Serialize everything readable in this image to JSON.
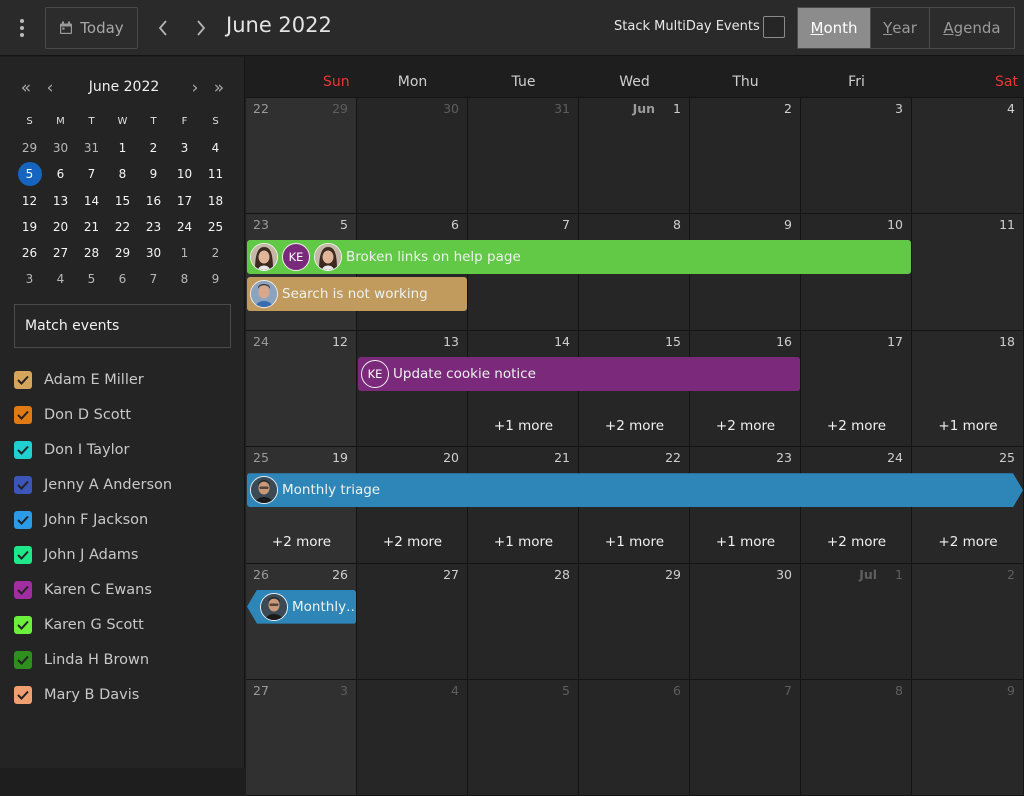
{
  "toolbar": {
    "today_label": "Today",
    "title": "June 2022",
    "stack_label": "Stack MultiDay Events",
    "views": [
      {
        "first": "M",
        "rest": "onth",
        "active": true
      },
      {
        "first": "Y",
        "rest": "ear",
        "active": false
      },
      {
        "first": "A",
        "rest": "genda",
        "active": false
      }
    ]
  },
  "mini": {
    "title": "June 2022",
    "first_nav": "«",
    "prev_nav": "‹",
    "next_nav": "›",
    "last_nav": "»",
    "dow": [
      "S",
      "M",
      "T",
      "W",
      "T",
      "F",
      "S"
    ],
    "weeks": [
      [
        "29",
        "30",
        "31",
        "1",
        "2",
        "3",
        "4"
      ],
      [
        "5",
        "6",
        "7",
        "8",
        "9",
        "10",
        "11"
      ],
      [
        "12",
        "13",
        "14",
        "15",
        "16",
        "17",
        "18"
      ],
      [
        "19",
        "20",
        "21",
        "22",
        "23",
        "24",
        "25"
      ],
      [
        "26",
        "27",
        "28",
        "29",
        "30",
        "1",
        "2"
      ],
      [
        "3",
        "4",
        "5",
        "6",
        "7",
        "8",
        "9"
      ]
    ],
    "out_of_month": [
      [
        0,
        0
      ],
      [
        0,
        1
      ],
      [
        0,
        2
      ],
      [
        4,
        5
      ],
      [
        4,
        6
      ],
      [
        5,
        0
      ],
      [
        5,
        1
      ],
      [
        5,
        2
      ],
      [
        5,
        3
      ],
      [
        5,
        4
      ],
      [
        5,
        5
      ],
      [
        5,
        6
      ]
    ],
    "selected": "5"
  },
  "match_label": "Match events",
  "people": [
    {
      "name": "Adam E Miller",
      "color": "#d6a55c"
    },
    {
      "name": "Don D Scott",
      "color": "#e07a14"
    },
    {
      "name": "Don I Taylor",
      "color": "#1fd1d1"
    },
    {
      "name": "Jenny A Anderson",
      "color": "#3b55b8"
    },
    {
      "name": "John F Jackson",
      "color": "#2b9be8"
    },
    {
      "name": "John J Adams",
      "color": "#1ee88a"
    },
    {
      "name": "Karen C Ewans",
      "color": "#a02ea0"
    },
    {
      "name": "Karen G Scott",
      "color": "#6cf03c"
    },
    {
      "name": "Linda H Brown",
      "color": "#2e8f1e"
    },
    {
      "name": "Mary B Davis",
      "color": "#f0a070"
    }
  ],
  "calendar": {
    "dow": [
      {
        "label": "Sun",
        "color": "#e53935"
      },
      {
        "label": "Mon",
        "color": "#cfcfcf"
      },
      {
        "label": "Tue",
        "color": "#cfcfcf"
      },
      {
        "label": "Wed",
        "color": "#cfcfcf"
      },
      {
        "label": "Thu",
        "color": "#cfcfcf"
      },
      {
        "label": "Fri",
        "color": "#cfcfcf"
      },
      {
        "label": "Sat",
        "color": "#e53935"
      }
    ],
    "weeks": [
      {
        "num": "22",
        "days": [
          {
            "d": "29",
            "dim": true
          },
          {
            "d": "30",
            "dim": true
          },
          {
            "d": "31",
            "dim": true
          },
          {
            "d": "1",
            "m": "Jun"
          },
          {
            "d": "2"
          },
          {
            "d": "3"
          },
          {
            "d": "4"
          }
        ]
      },
      {
        "num": "23",
        "days": [
          {
            "d": "5"
          },
          {
            "d": "6"
          },
          {
            "d": "7"
          },
          {
            "d": "8"
          },
          {
            "d": "9"
          },
          {
            "d": "10"
          },
          {
            "d": "11"
          }
        ]
      },
      {
        "num": "24",
        "days": [
          {
            "d": "12"
          },
          {
            "d": "13"
          },
          {
            "d": "14"
          },
          {
            "d": "15"
          },
          {
            "d": "16"
          },
          {
            "d": "17"
          },
          {
            "d": "18"
          }
        ]
      },
      {
        "num": "25",
        "days": [
          {
            "d": "19"
          },
          {
            "d": "20"
          },
          {
            "d": "21"
          },
          {
            "d": "22"
          },
          {
            "d": "23"
          },
          {
            "d": "24"
          },
          {
            "d": "25"
          }
        ]
      },
      {
        "num": "26",
        "days": [
          {
            "d": "26"
          },
          {
            "d": "27"
          },
          {
            "d": "28"
          },
          {
            "d": "29"
          },
          {
            "d": "30"
          },
          {
            "d": "1",
            "m": "Jul",
            "dim": true
          },
          {
            "d": "2",
            "dim": true
          }
        ]
      },
      {
        "num": "27",
        "days": [
          {
            "d": "3",
            "dim": true
          },
          {
            "d": "4",
            "dim": true
          },
          {
            "d": "5",
            "dim": true
          },
          {
            "d": "6",
            "dim": true
          },
          {
            "d": "7",
            "dim": true
          },
          {
            "d": "8",
            "dim": true
          },
          {
            "d": "9",
            "dim": true
          }
        ]
      }
    ],
    "events": [
      {
        "title": "Broken links on help page",
        "week": 1,
        "start": 0,
        "end": 6,
        "lane": 0,
        "color": "#62c946",
        "avatars": [
          "photo-woman",
          "KE",
          "photo-woman"
        ],
        "shape": "plain"
      },
      {
        "title": "Search is not working",
        "week": 1,
        "start": 0,
        "end": 2,
        "lane": 1,
        "color": "#c19a5e",
        "avatars": [
          "photo-man"
        ],
        "shape": "plain"
      },
      {
        "title": "Update cookie notice",
        "week": 2,
        "start": 1,
        "end": 5,
        "lane": 0,
        "color": "#7b2a7b",
        "avatars": [
          "KE"
        ],
        "shape": "plain"
      },
      {
        "title": "Monthly triage",
        "week": 3,
        "start": 0,
        "end": 7,
        "lane": 0,
        "color": "#2e86b8",
        "avatars": [
          "photo-man2"
        ],
        "shape": "arrow-right"
      },
      {
        "title": "Monthly…",
        "week": 4,
        "start": 0,
        "end": 1,
        "lane": 0,
        "color": "#2e86b8",
        "avatars": [
          "photo-man2"
        ],
        "shape": "arrow-left"
      }
    ],
    "more": [
      {
        "week": 2,
        "col": 2,
        "label": "+1 more"
      },
      {
        "week": 2,
        "col": 3,
        "label": "+2 more"
      },
      {
        "week": 2,
        "col": 4,
        "label": "+2 more"
      },
      {
        "week": 2,
        "col": 5,
        "label": "+2 more"
      },
      {
        "week": 2,
        "col": 6,
        "label": "+1 more"
      },
      {
        "week": 3,
        "col": 0,
        "label": "+2 more"
      },
      {
        "week": 3,
        "col": 1,
        "label": "+2 more"
      },
      {
        "week": 3,
        "col": 2,
        "label": "+1 more"
      },
      {
        "week": 3,
        "col": 3,
        "label": "+1 more"
      },
      {
        "week": 3,
        "col": 4,
        "label": "+1 more"
      },
      {
        "week": 3,
        "col": 5,
        "label": "+2 more"
      },
      {
        "week": 3,
        "col": 6,
        "label": "+2 more"
      }
    ]
  }
}
